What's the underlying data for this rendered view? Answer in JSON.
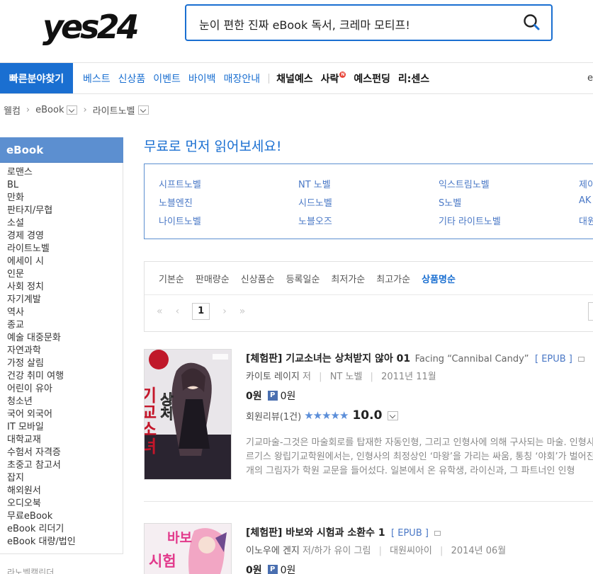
{
  "header": {
    "logo_text": "yes24",
    "search_value": "눈이 편한 진짜 eBook 독서, 크레마 모티프!"
  },
  "nav": {
    "quick_label": "빠른분야찾기",
    "blue_items": [
      "베스트",
      "신상품",
      "이벤트",
      "바이백",
      "매장안내"
    ],
    "dark_items": [
      "채널예스",
      "사락",
      "예스펀딩",
      "리:센스"
    ],
    "new_badge": "N",
    "cut_text": "e"
  },
  "breadcrumb": [
    "웰컴",
    "eBook",
    "라이트노벨"
  ],
  "sidebar": {
    "title": "eBook",
    "items": [
      "로맨스",
      "BL",
      "만화",
      "판타지/무협",
      "소설",
      "경제 경영",
      "라이트노벨",
      "에세이 시",
      "인문",
      "사회 정치",
      "자기계발",
      "역사",
      "종교",
      "예술 대중문화",
      "자연과학",
      "가정 살림",
      "건강 취미 여행",
      "어린이 유아",
      "청소년",
      "국어 외국어",
      "IT 모바일",
      "대학교재",
      "수험서 자격증",
      "초중고 참고서",
      "잡지",
      "해외원서",
      "오디오북",
      "무료eBook",
      "eBook 리더기",
      "eBook 대량/법인"
    ],
    "footer_cut": "라노벨캘린더"
  },
  "free": {
    "title": "무료로 먼저 읽어보세요!",
    "links": [
      [
        "시프트노벨",
        "NT 노벨",
        "익스트림노벨",
        "제이"
      ],
      [
        "노블엔진",
        "시드노벨",
        "S노벨",
        "AK"
      ],
      [
        "나이트노벨",
        "노블오즈",
        "기타 라이트노벨",
        "대원"
      ]
    ]
  },
  "sort": {
    "options": [
      "기본순",
      "판매량순",
      "신상품순",
      "등록일순",
      "최저가순",
      "최고가순",
      "상품명순"
    ],
    "active": "상품명순",
    "current_page": "1"
  },
  "products": [
    {
      "title": "[체험판] 기교소녀는 상처받지 않아 01",
      "subtitle": "Facing “Cannibal Candy”",
      "format": "[ EPUB ]",
      "author": "카이토 레이지",
      "role": "저",
      "publisher": "NT 노벨",
      "date": "2011년 11월",
      "price": "0원",
      "points": "0원",
      "points_badge": "P",
      "review_label": "회원리뷰(1건)",
      "stars": "★★★★★",
      "rating": 5,
      "score": "10.0",
      "desc": [
        "기교마술-그것은 마술회로를 탑재한 자동인형, 그리고 인형사에 의해 구사되는 마술. 인형사",
        "르기스 왕립기교학원에서는, 인형사의 최정상인 ‘마왕’을 가리는 싸움, 통칭 ‘야회’가 벌어진다",
        "개의 그림자가 학원 교문을 들어섰다. 일본에서 온 유학생, 라이신과, 그 파트너인 인형"
      ],
      "cover_title": "기교소녀",
      "cover_title2": "상처"
    },
    {
      "title": "[체험판] 바보와 시험과 소환수 1",
      "format": "[ EPUB ]",
      "author": "이노우에 겐지",
      "role": "저/하가 유이 그림",
      "publisher": "대원씨아이",
      "date": "2014년 06월",
      "price": "0원",
      "points": "0원",
      "points_badge": "P",
      "cover_title": "바보",
      "cover_title2": "시험"
    }
  ],
  "colors": {
    "brand_blue": "#1a6fd1",
    "sidebar_blue": "#5c8fd0",
    "link_blue": "#4a78c6",
    "star_blue": "#5b8ed9"
  }
}
